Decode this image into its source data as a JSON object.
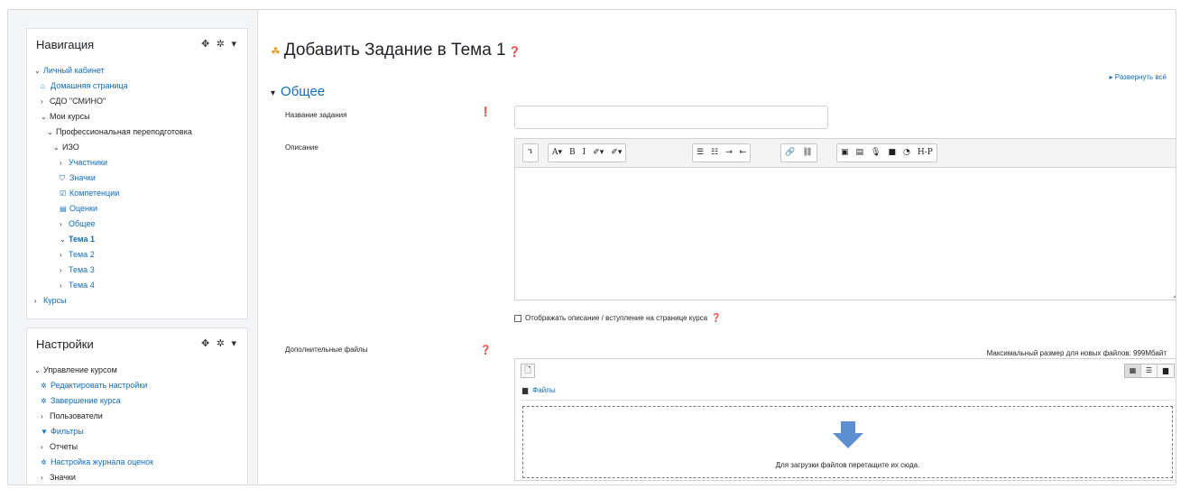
{
  "navigation_block": {
    "title": "Навигация",
    "controls": "✥ ✲ ▾",
    "items": [
      {
        "label": "Личный кабинет",
        "arrow": "⌄",
        "icon": "",
        "style": "link"
      },
      {
        "label": "Домашняя страница",
        "arrow": "",
        "icon": "home-icon",
        "style": "link"
      },
      {
        "label": "СДО \"СМИНО\"",
        "arrow": "›",
        "icon": "",
        "style": "plain"
      },
      {
        "label": "Мои курсы",
        "arrow": "⌄",
        "icon": "",
        "style": "plain"
      },
      {
        "label": "Профессиональная переподготовка",
        "arrow": "⌄",
        "icon": "",
        "style": "plain"
      },
      {
        "label": "ИЗО",
        "arrow": "⌄",
        "icon": "",
        "style": "plain"
      },
      {
        "label": "Участники",
        "arrow": "›",
        "icon": "",
        "style": "link"
      },
      {
        "label": "Значки",
        "arrow": "",
        "icon": "shield-icon",
        "style": "link"
      },
      {
        "label": "Компетенции",
        "arrow": "",
        "icon": "checkbox-icon",
        "style": "link"
      },
      {
        "label": "Оценки",
        "arrow": "",
        "icon": "table-icon",
        "style": "link"
      },
      {
        "label": "Общее",
        "arrow": "›",
        "icon": "",
        "style": "link"
      },
      {
        "label": "Тема 1",
        "arrow": "⌄",
        "icon": "",
        "style": "bold"
      },
      {
        "label": "Тема 2",
        "arrow": "›",
        "icon": "",
        "style": "link"
      },
      {
        "label": "Тема 3",
        "arrow": "›",
        "icon": "",
        "style": "link"
      },
      {
        "label": "Тема 4",
        "arrow": "›",
        "icon": "",
        "style": "link"
      },
      {
        "label": "Курсы",
        "arrow": "›",
        "icon": "",
        "style": "link"
      }
    ]
  },
  "settings_block": {
    "title": "Настройки",
    "controls": "✥ ✲ ▾",
    "items": [
      {
        "label": "Управление курсом",
        "arrow": "⌄",
        "icon": "",
        "style": "plain"
      },
      {
        "label": "Редактировать настройки",
        "arrow": "",
        "icon": "gear-icon",
        "style": "link"
      },
      {
        "label": "Завершение курса",
        "arrow": "",
        "icon": "gear-icon",
        "style": "link"
      },
      {
        "label": "Пользователи",
        "arrow": "›",
        "icon": "",
        "style": "plain"
      },
      {
        "label": "Фильтры",
        "arrow": "",
        "icon": "filter-icon",
        "style": "link"
      },
      {
        "label": "Отчеты",
        "arrow": "›",
        "icon": "",
        "style": "plain"
      },
      {
        "label": "Настройка журнала оценок",
        "arrow": "",
        "icon": "gear-icon",
        "style": "link"
      },
      {
        "label": "Значки",
        "arrow": "›",
        "icon": "",
        "style": "plain"
      }
    ]
  },
  "page": {
    "title": "Добавить Задание в Тема 1",
    "expand_all": "▸ Развернуть всё",
    "section_title": "Общее"
  },
  "form": {
    "name_label": "Название задания",
    "description_label": "Описание",
    "show_description_label": "Отображать описание / вступление на странице курса",
    "files_label": "Дополнительные файлы",
    "max_size_text": "Максимальный размер для новых файлов: 999Мбайт",
    "files_path": "Файлы",
    "drop_text": "Для загрузки файлов перетащите их сюда."
  },
  "editor_toolbar": {
    "groups": [
      [
        "↴"
      ],
      [
        "A▾",
        "B",
        "I",
        "✐▾",
        "✐▾"
      ],
      [
        "☰",
        "☷",
        "⇥",
        "⇤"
      ],
      [
        "🔗",
        "⛓"
      ],
      [
        "▣",
        "▤",
        "🎙",
        "■",
        "◔",
        "H-P"
      ]
    ]
  },
  "colors": {
    "link": "#0f6cbf",
    "required": "#cc0000",
    "drop_arrow": "#5b8fd1"
  }
}
